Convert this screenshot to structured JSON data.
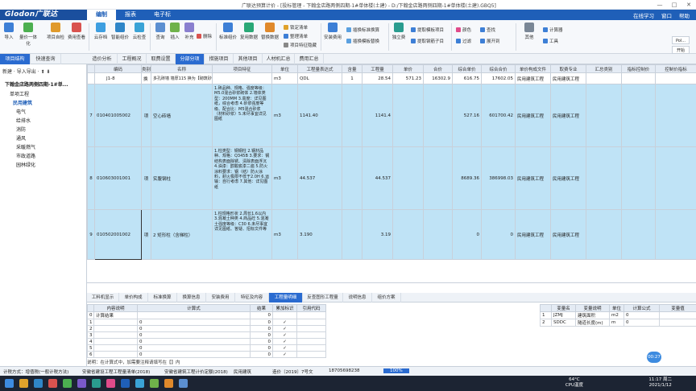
{
  "titlebar": {
    "title": "广联达预算计价 - [投标管理 - 下翰金店路两侧四期-1#单体楼(土建) - D:/下翰金店路两侧四期-1#单体楼(土建).GBQ5]",
    "min": "—",
    "max": "□",
    "close": "✕"
  },
  "menubar": {
    "logo": "Glodon广联达",
    "items": [
      "编制",
      "报表",
      "电子标"
    ],
    "right": [
      "在线学习",
      "窗口",
      "帮助"
    ]
  },
  "ribbon": {
    "big": [
      "导入",
      "量价一体化",
      "项目自检",
      "费用查看",
      "云存档",
      "智能组价",
      "云检查",
      "查询",
      "插入",
      "补充",
      "删除",
      "标准组价",
      "复用数据",
      "替换数据",
      "安装费用",
      "独立费",
      "颜色",
      "查找",
      "其他",
      "工具"
    ],
    "small": [
      "锁定清单",
      "整理清单",
      "项目特征隐藏",
      "插换标准换算",
      "插换模板替换",
      "插换清单组价",
      "提取模板项目",
      "提取钢筋子目",
      "过滤",
      "展开到"
    ],
    "right_button": "计算器",
    "side_buttons": [
      "Pol...",
      "开始"
    ]
  },
  "tabs": [
    "项目结构",
    "快速查询",
    "造价分析",
    "工程概况",
    "取费设置",
    "分部分项",
    "措施项目",
    "其他项目",
    "人材机汇总",
    "费用汇总"
  ],
  "left": {
    "toolbar": "新建 · 导入导出 · ⬆ ⬇",
    "project": "下翰金店路两侧四期-1#单...",
    "items": [
      "单项工程",
      "民用建筑",
      "电气",
      "给排水",
      "消防",
      "通风",
      "采暖燃气",
      "市政道路",
      "园林绿化"
    ]
  },
  "grid": {
    "headers": [
      "编码",
      "类别",
      "名称",
      "项目特征",
      "单位",
      "工程量表达式",
      "含量",
      "工程量",
      "单价",
      "合价",
      "综合单价",
      "综合合价",
      "单价构成文件",
      "取费专业",
      "汇总类别",
      "指标控制价",
      "控制价指标"
    ],
    "subrow": {
      "code": "J1-8",
      "type": "换",
      "name": "多孔砖墙 墙厚115 换为【砌筑砂浆M5】",
      "unit": "m3",
      "expr": "QDL",
      "content": "1",
      "qty": "28.54",
      "price": "571.23",
      "total": "16302.9",
      "unit_price": "616.75",
      "unit_total": "17602.05",
      "file": "民用建筑工程",
      "spec": "民用建筑工程"
    },
    "rows": [
      {
        "no": "7",
        "code": "010401005002",
        "type": "项",
        "name": "空心砖墙",
        "feature": "1.砖品种、规格、强度等级：M5.0混合砂浆砌体 2.墙体类型：200MM 3.高度：详见图纸，综合考虑 4.砂浆强度等级、配合比：M5混合砂浆 （材料砂浆）5.未尽事宜详见图纸",
        "unit": "m3",
        "expr": "1141.40",
        "qty": "1141.4",
        "unit_price": "527.16",
        "unit_total": "601700.42",
        "file": "民用建筑工程",
        "spec": "民用建筑工程"
      },
      {
        "no": "8",
        "code": "010603001001",
        "type": "项",
        "name": "实腹钢柱",
        "feature": "1.柱类型：钢钢柱 2.钢材品种、规格：Q345B 3.要求：钢结构表面除锈、清除表面浮沉 4.油漆：醇酸底漆二遍 5.防火涂料要求：钢（结）防火涂料，耐火极限不低于2.0H 6.运输：自行考虑 7.其他：详见图纸",
        "unit": "m3",
        "expr": "44.537",
        "qty": "44.537",
        "unit_price": "8689.36",
        "unit_total": "386998.03",
        "file": "民用建筑工程",
        "spec": "民用建筑工程"
      },
      {
        "no": "9",
        "code": "010502001002",
        "type": "项",
        "name": "2 矩形柱（含梯柱）",
        "feature": "1.柱规格形状 2.周长1.6以内 3.混凝土种类 4.商品砼 5.混凝土强度等级：C30 6.未尽事宜详见图纸、答疑、招标文件等",
        "unit": "m3",
        "expr": "3.190",
        "qty": "3.19",
        "unit_price": "0",
        "unit_total": "0",
        "file": "民用建筑工程",
        "spec": "民用建筑工程"
      }
    ]
  },
  "bottom_tabs": [
    "工料机显示",
    "单价构成",
    "标准换算",
    "换算信息",
    "安装费用",
    "特征及内容",
    "工程量明细",
    "反查图形工程量",
    "说明信息",
    "组价方案"
  ],
  "bottom_left": {
    "headers": [
      "",
      "内容说明",
      "计算式",
      "结果",
      "累加标识",
      "引用代码"
    ],
    "rows": [
      [
        "0",
        "计算结果",
        "",
        "0",
        "",
        ""
      ],
      [
        "1",
        "",
        "0",
        "0",
        "✓",
        ""
      ],
      [
        "2",
        "",
        "0",
        "0",
        "✓",
        ""
      ],
      [
        "3",
        "",
        "0",
        "0",
        "✓",
        ""
      ],
      [
        "4",
        "",
        "0",
        "0",
        "✓",
        ""
      ],
      [
        "5",
        "",
        "0",
        "0",
        "✓",
        ""
      ],
      [
        "6",
        "",
        "0",
        "0",
        "✓",
        ""
      ]
    ]
  },
  "bottom_right": {
    "headers": [
      "",
      "变量名",
      "变量说明",
      "单位",
      "计算公式",
      "变量值"
    ],
    "rows": [
      [
        "1",
        "JZMJ",
        "建筑面积",
        "m2",
        "0",
        ""
      ],
      [
        "2",
        "SDDC",
        "隧道长度(m)",
        "m",
        "0",
        ""
      ]
    ]
  },
  "hint": "说明：在计算式中，加需要注释请填写在【】内",
  "status": {
    "calc": "计税方式：增值税(一般计税方法)",
    "std1": "安徽省建设工程工程量清单(2018)",
    "std2": "安徽省建筑工程计价定额(2018)",
    "spec": "民用建筑",
    "price": "造价〔2019〕7号文",
    "phone": "18705698238",
    "zoom": "100%",
    "bubble": "00:27"
  },
  "taskbar": {
    "temp": "64°C",
    "cpu": "CPU温度",
    "time": "11:17 周二",
    "date": "2021/1/12"
  },
  "colors": {
    "brand": "#1f5fb8",
    "row_highlight": "#bfe3f6",
    "active_tab": "#2a6bd0"
  }
}
